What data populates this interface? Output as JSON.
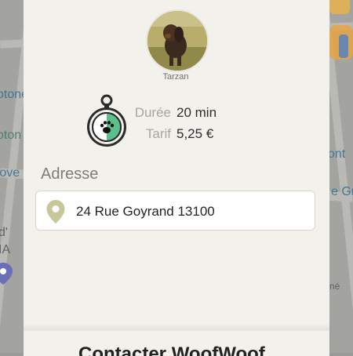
{
  "pet": {
    "name": "Tarzan"
  },
  "walk": {
    "duration_label": "Durée",
    "duration_value": "20 min",
    "rate_label": "Tarif",
    "rate_value": "5,25 €"
  },
  "address": {
    "section_title": "Adresse",
    "value": "24 Rue Goyrand 13100"
  },
  "bottom": {
    "title": "Contacter WoofWoof"
  },
  "map_labels": {
    "left_1": "otone",
    "left_2": "oton",
    "left_3": "rove",
    "left_4": "d'",
    "left_5": "IA",
    "right_1": "ont",
    "right_2": "e Gra",
    "right_3": "né"
  },
  "colors": {
    "accent": "#5bbf8a",
    "pin": "#c7c79a",
    "card": "#f3f1ec"
  },
  "icons": {
    "timer": "stopwatch-paw-icon",
    "location": "location-pin-icon",
    "map_pin": "map-marker-icon"
  }
}
